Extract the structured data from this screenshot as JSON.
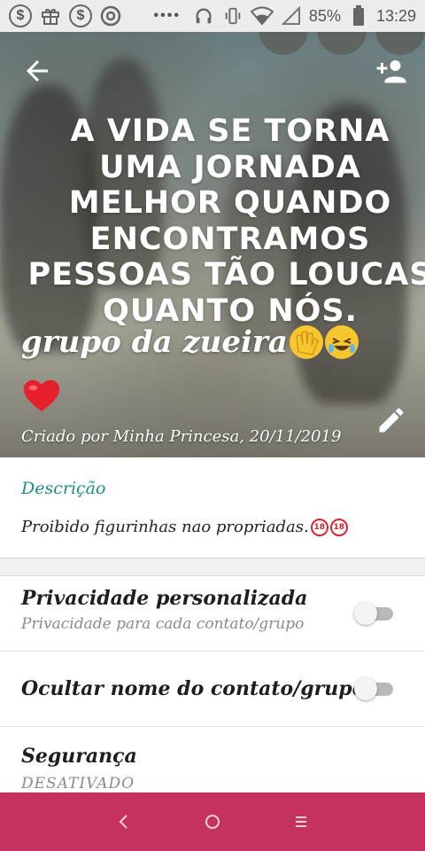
{
  "status_bar": {
    "battery": "85%",
    "time": "13:29",
    "icons": [
      "dollar-icon",
      "gift-icon",
      "dollar-icon",
      "chrome-icon",
      "more-dots-icon",
      "headphones-icon",
      "vibrate-icon",
      "wifi-icon",
      "signal-icon",
      "battery-icon"
    ]
  },
  "header": {
    "quote_lines": [
      "A VIDA SE TORNA",
      "UMA JORNADA",
      "MELHOR QUANDO",
      "ENCONTRAMOS",
      "PESSOAS TÃO LOUCAS",
      "QUANTO NÓS."
    ],
    "group_name": "grupo da zueira",
    "created_by": "Criado por Minha Princesa, 20/11/2019"
  },
  "description": {
    "title": "Descrição",
    "text": "Proibido figurinhas nao propriadas."
  },
  "settings": {
    "custom_privacy": {
      "title": "Privacidade personalizada",
      "subtitle": "Privacidade para cada contato/grupo",
      "enabled": false
    },
    "hide_contact_name": {
      "title": "Ocultar nome do contato/grupo",
      "enabled": false
    },
    "security": {
      "title": "Segurança",
      "subtitle": "DESATIVADO"
    }
  },
  "colors": {
    "accent_teal": "#1a8f87",
    "nav_bar": "#c6325e"
  }
}
